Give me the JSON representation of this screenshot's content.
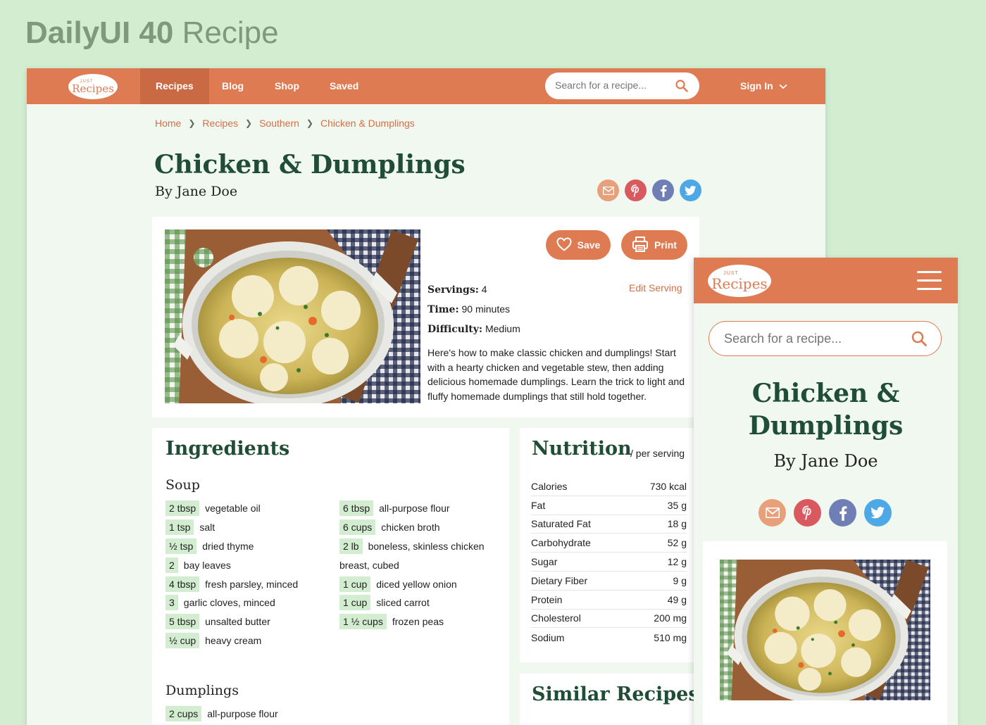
{
  "heading": {
    "bold": "DailyUI 40",
    "light": "Recipe"
  },
  "brand": {
    "just": "JUST",
    "name": "Recipes"
  },
  "nav": {
    "items": [
      {
        "label": "Recipes",
        "active": true
      },
      {
        "label": "Blog"
      },
      {
        "label": "Shop"
      },
      {
        "label": "Saved"
      }
    ],
    "search_placeholder": "Search for a recipe...",
    "signin": "Sign In"
  },
  "breadcrumb": [
    "Home",
    "Recipes",
    "Southern",
    "Chicken & Dumplings"
  ],
  "recipe": {
    "title": "Chicken & Dumplings",
    "byline": "By Jane Doe",
    "save": "Save",
    "print": "Print",
    "servings_label": "Servings:",
    "servings": "4",
    "time_label": "Time:",
    "time": "90 minutes",
    "difficulty_label": "Difficulty:",
    "difficulty": "Medium",
    "edit_serving": "Edit Serving",
    "description": "Here's how to make classic chicken and dumplings! Start with a hearty chicken and vegetable stew, then adding delicious homemade dumplings. Learn the trick to light and fluffy homemade dumplings that still hold together."
  },
  "ingredients": {
    "title": "Ingredients",
    "soup_title": "Soup",
    "soup_left": [
      {
        "qty": "2 tbsp",
        "name": "vegetable oil"
      },
      {
        "qty": "1 tsp",
        "name": "salt"
      },
      {
        "qty": "½ tsp",
        "name": "dried thyme"
      },
      {
        "qty": "2",
        "name": "bay leaves"
      },
      {
        "qty": "4 tbsp",
        "name": "fresh parsley, minced"
      },
      {
        "qty": "3",
        "name": "garlic cloves, minced"
      },
      {
        "qty": "5 tbsp",
        "name": "unsalted butter"
      },
      {
        "qty": "½ cup",
        "name": "heavy cream"
      }
    ],
    "soup_right": [
      {
        "qty": "6 tbsp",
        "name": "all-purpose flour"
      },
      {
        "qty": "6 cups",
        "name": "chicken broth"
      },
      {
        "qty": "2 lb",
        "name": "boneless, skinless chicken",
        "cont": "breast, cubed"
      },
      {
        "qty": "1 cup",
        "name": "diced yellow onion"
      },
      {
        "qty": "1 cup",
        "name": "sliced carrot"
      },
      {
        "qty": "1 ½ cups",
        "name": "frozen peas"
      }
    ],
    "dumplings_title": "Dumplings",
    "dumplings": [
      {
        "qty": "2 cups",
        "name": "all-purpose flour"
      }
    ]
  },
  "nutrition": {
    "title": "Nutrition",
    "per": "/ per serving",
    "rows": [
      {
        "label": "Calories",
        "value": "730 kcal"
      },
      {
        "label": "Fat",
        "value": "35 g"
      },
      {
        "label": "Saturated Fat",
        "value": "18 g"
      },
      {
        "label": "Carbohydrate",
        "value": "52 g"
      },
      {
        "label": "Sugar",
        "value": "12 g"
      },
      {
        "label": "Dietary Fiber",
        "value": "9 g"
      },
      {
        "label": "Protein",
        "value": "49 g"
      },
      {
        "label": "Cholesterol",
        "value": "200 mg"
      },
      {
        "label": "Sodium",
        "value": "510 mg"
      }
    ]
  },
  "similar": {
    "title": "Similar Recipes"
  },
  "mobile": {
    "search_placeholder": "Search for a recipe...",
    "title_line1": "Chicken &",
    "title_line2": "Dumplings",
    "byline": "By Jane Doe"
  },
  "colors": {
    "accent": "#df7b53",
    "green_dark": "#1f4d35",
    "bg": "#d2edd0",
    "page": "#f1f8ef"
  }
}
